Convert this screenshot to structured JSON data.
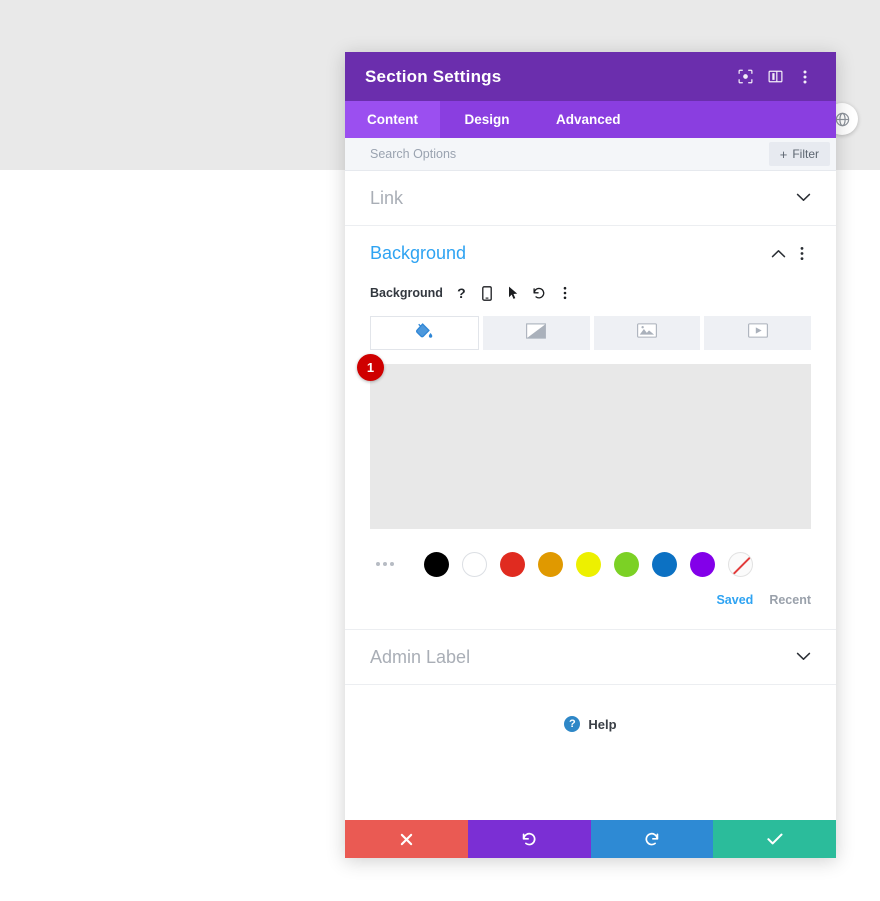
{
  "window": {
    "title": "Section Settings",
    "header_icons": [
      {
        "name": "focus-target-icon",
        "label": "Focus"
      },
      {
        "name": "panel-layout-icon",
        "label": "Layout"
      },
      {
        "name": "more-vertical-icon",
        "label": "More"
      }
    ]
  },
  "tabs": [
    {
      "label": "Content",
      "active": true
    },
    {
      "label": "Design",
      "active": false
    },
    {
      "label": "Advanced",
      "active": false
    }
  ],
  "search": {
    "placeholder": "Search Options",
    "value": "",
    "filter_label": "Filter",
    "filter_plus": "+"
  },
  "sections": {
    "link": {
      "title": "Link",
      "expanded": false
    },
    "background": {
      "title": "Background",
      "expanded": true,
      "field_label": "Background",
      "field_icons": [
        {
          "name": "help-question-icon",
          "glyph": "?"
        },
        {
          "name": "responsive-mobile-icon"
        },
        {
          "name": "hover-cursor-icon"
        },
        {
          "name": "reset-undo-icon"
        },
        {
          "name": "more-vertical-icon"
        }
      ],
      "type_tabs": [
        {
          "name": "background-color-tab",
          "icon": "paint-bucket-icon",
          "active": true
        },
        {
          "name": "background-gradient-tab",
          "icon": "gradient-icon",
          "active": false
        },
        {
          "name": "background-image-tab",
          "icon": "image-icon",
          "active": false
        },
        {
          "name": "background-video-tab",
          "icon": "video-icon",
          "active": false
        }
      ],
      "badge_count": "1",
      "preview_color": "#e8e8e8",
      "swatches": [
        {
          "name": "swatch-black",
          "color": "#000000"
        },
        {
          "name": "swatch-white",
          "color": "#ffffff",
          "bordered": true
        },
        {
          "name": "swatch-red",
          "color": "#e02b20"
        },
        {
          "name": "swatch-orange",
          "color": "#e09900"
        },
        {
          "name": "swatch-yellow",
          "color": "#edf000"
        },
        {
          "name": "swatch-green",
          "color": "#7cd125"
        },
        {
          "name": "swatch-blue",
          "color": "#0c71c3"
        },
        {
          "name": "swatch-purple",
          "color": "#8300e9"
        },
        {
          "name": "swatch-none",
          "color": "none"
        }
      ],
      "saved_label": "Saved",
      "recent_label": "Recent"
    },
    "admin_label": {
      "title": "Admin Label",
      "expanded": false
    }
  },
  "help": {
    "label": "Help",
    "badge": "?"
  },
  "footer": [
    {
      "name": "cancel-button",
      "icon": "close-x-icon",
      "color": "#ea5a53"
    },
    {
      "name": "undo-button",
      "icon": "undo-icon",
      "color": "#7b2fd4"
    },
    {
      "name": "redo-button",
      "icon": "redo-icon",
      "color": "#2e8ad4"
    },
    {
      "name": "save-button",
      "icon": "check-icon",
      "color": "#2bbc9b"
    }
  ],
  "floating_button": {
    "name": "page-settings-round-button",
    "icon": "globe-icon"
  },
  "colors": {
    "header_purple": "#6b2ead",
    "tab_purple": "#8a3ee0",
    "tab_active_purple": "#9b4ff0",
    "accent_blue": "#2ea3f2",
    "badge_red": "#cf0000"
  }
}
